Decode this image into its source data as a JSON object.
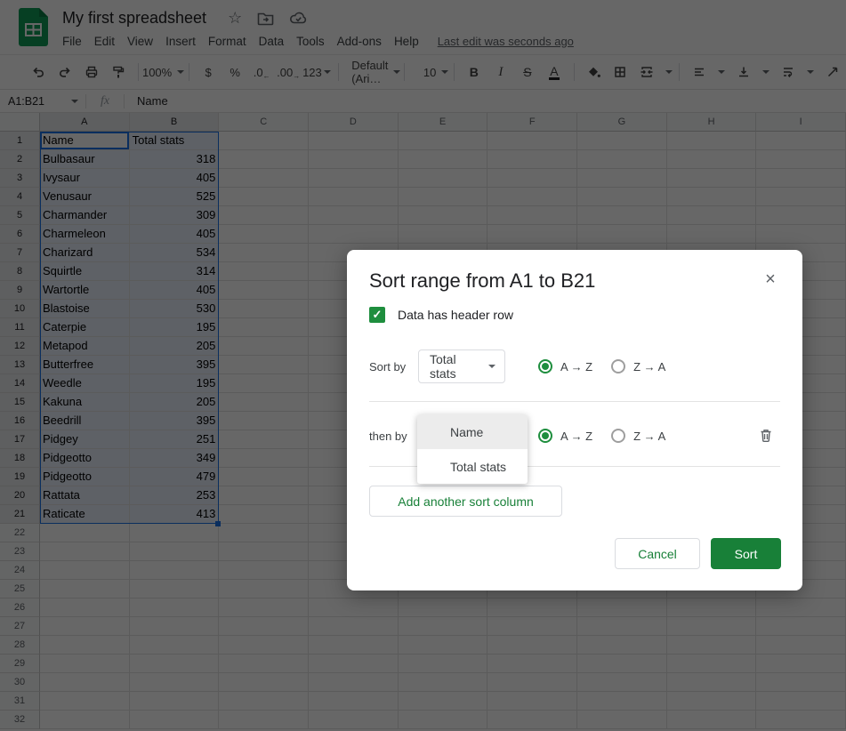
{
  "titlebar": {
    "title": "My first spreadsheet",
    "menus": [
      "File",
      "Edit",
      "View",
      "Insert",
      "Format",
      "Data",
      "Tools",
      "Add-ons",
      "Help"
    ],
    "last_edit": "Last edit was seconds ago"
  },
  "toolbar": {
    "zoom": "100%",
    "currency": "$",
    "percent": "%",
    "decrease_decimal": ".0",
    "increase_decimal": ".00",
    "more_formats": "123",
    "font": "Default (Ari…",
    "font_size": "10",
    "bold": "B",
    "italic": "I",
    "strikethrough": "S",
    "text_color": "A"
  },
  "formula_bar": {
    "range": "A1:B21",
    "fx": "fx",
    "value": "Name"
  },
  "sheet": {
    "columns": [
      "A",
      "B",
      "C",
      "D",
      "E",
      "F",
      "G",
      "H",
      "I"
    ],
    "row_count": 32,
    "selected_columns": [
      "A",
      "B"
    ],
    "selected_last_row": 21,
    "active_cell": "A1",
    "table": [
      [
        "Name",
        "Total stats"
      ],
      [
        "Bulbasaur",
        "318"
      ],
      [
        "Ivysaur",
        "405"
      ],
      [
        "Venusaur",
        "525"
      ],
      [
        "Charmander",
        "309"
      ],
      [
        "Charmeleon",
        "405"
      ],
      [
        "Charizard",
        "534"
      ],
      [
        "Squirtle",
        "314"
      ],
      [
        "Wartortle",
        "405"
      ],
      [
        "Blastoise",
        "530"
      ],
      [
        "Caterpie",
        "195"
      ],
      [
        "Metapod",
        "205"
      ],
      [
        "Butterfree",
        "395"
      ],
      [
        "Weedle",
        "195"
      ],
      [
        "Kakuna",
        "205"
      ],
      [
        "Beedrill",
        "395"
      ],
      [
        "Pidgey",
        "251"
      ],
      [
        "Pidgeotto",
        "349"
      ],
      [
        "Pidgeotto",
        "479"
      ],
      [
        "Rattata",
        "253"
      ],
      [
        "Raticate",
        "413"
      ]
    ]
  },
  "dialog": {
    "title": "Sort range from A1 to B21",
    "header_checkbox_label": "Data has header row",
    "checkbox_checked": true,
    "sort_by_label": "Sort by",
    "sort_by_value": "Total stats",
    "then_by_label": "then by",
    "asc_label": "A → Z",
    "desc_label": "Z → A",
    "sort_by_direction": "asc",
    "then_by_direction": "asc",
    "add_column_label": "Add another sort column",
    "cancel_label": "Cancel",
    "sort_label": "Sort"
  },
  "dropdown": {
    "options": [
      "Name",
      "Total stats"
    ],
    "highlighted": "Name"
  },
  "icons": {
    "star": "☆",
    "close": "×",
    "check": "✓",
    "arrow_left": "←",
    "arrow_right": "→"
  },
  "colors": {
    "accent_green": "#188038",
    "checkbox_green": "#1e8e3e",
    "selection_blue": "#1a73e8",
    "logo_green": "#0f9d58"
  }
}
